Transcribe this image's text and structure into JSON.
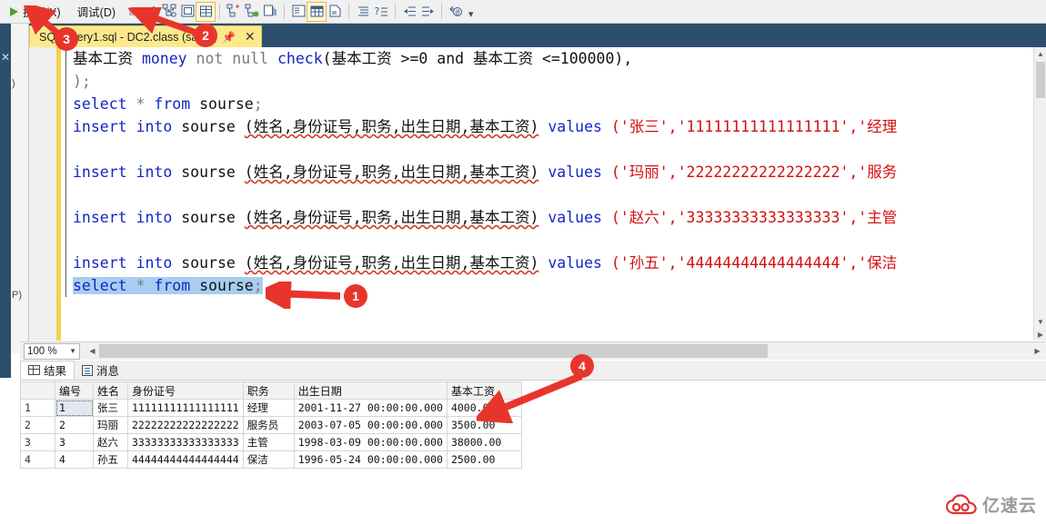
{
  "toolbar": {
    "run_label": "执行(X)",
    "debug_label": "调试(D)",
    "icons": [
      {
        "name": "run-icon"
      },
      {
        "name": "stop-icon"
      },
      {
        "name": "parse-check-icon"
      },
      {
        "name": "display-estimated-execution-plan-icon"
      },
      {
        "name": "query-options-icon"
      },
      {
        "name": "include-actual-execution-plan-icon"
      },
      {
        "name": "include-client-statistics-icon"
      },
      {
        "name": "include-live-query-statistics-icon"
      },
      {
        "name": "specify-values-for-template-parameters-icon"
      },
      {
        "name": "results-to-text-icon"
      },
      {
        "name": "results-to-grid-icon"
      },
      {
        "name": "results-to-file-icon"
      },
      {
        "name": "comment-out-icon"
      },
      {
        "name": "uncomment-icon"
      },
      {
        "name": "decrease-indent-icon"
      },
      {
        "name": "increase-indent-icon"
      },
      {
        "name": "connection-icon"
      },
      {
        "name": "toolbar-overflow-icon"
      }
    ]
  },
  "tab": {
    "title": "SQLQuery1.sql - DC2.class (sa (5",
    "pin_icon": "pin-icon",
    "close_icon": "close-icon"
  },
  "editor": {
    "lines": [
      {
        "id": "l1",
        "text": "基本工资 money not null check(基本工资 >=0 and 基本工资 <=100000),"
      },
      {
        "id": "l2",
        "text": ");"
      },
      {
        "id": "l3",
        "text": "select * from sourse;"
      },
      {
        "id": "l4",
        "text": "insert into sourse (姓名,身份证号,职务,出生日期,基本工资) values ('张三','11111111111111111','经理"
      },
      {
        "id": "l5",
        "text": ""
      },
      {
        "id": "l6",
        "text": "insert into sourse (姓名,身份证号,职务,出生日期,基本工资) values ('玛丽','22222222222222222','服务"
      },
      {
        "id": "l7",
        "text": ""
      },
      {
        "id": "l8",
        "text": "insert into sourse (姓名,身份证号,职务,出生日期,基本工资) values ('赵六','33333333333333333','主管"
      },
      {
        "id": "l9",
        "text": ""
      },
      {
        "id": "l10",
        "text": "insert into sourse (姓名,身份证号,职务,出生日期,基本工资) values ('孙五','44444444444444444','保洁"
      },
      {
        "id": "l11",
        "text": "select * from sourse;"
      }
    ],
    "tokens": {
      "kw_money": "money",
      "kw_not": "not",
      "kw_null": "null",
      "kw_check": "check",
      "kw_select": "select",
      "kw_from": "from",
      "kw_insert": "insert",
      "kw_into": "into",
      "kw_values": "values",
      "col_salary": "基本工资",
      "col_name": "姓名",
      "col_idcard": "身份证号",
      "col_title": "职务",
      "col_birth": "出生日期",
      "tbl_sourse": "sourse",
      "star": "*",
      "semi": ";",
      "close_paren": ");",
      "check_cond": "(基本工资 >=0 and 基本工资 <=100000),",
      "cols_paren": "(姓名,身份证号,职务,出生日期,基本工资)",
      "v1": "('张三','11111111111111111','经理",
      "v2": "('玛丽','22222222222222222','服务",
      "v3": "('赵六','33333333333333333','主管",
      "v4": "('孙五','44444444444444444','保洁"
    }
  },
  "zoom": {
    "value": "100 %",
    "caret_icon": "chevron-down-icon"
  },
  "results_tabs": [
    {
      "label": "结果",
      "icon": "grid-icon",
      "active": true
    },
    {
      "label": "消息",
      "icon": "messages-icon",
      "active": false
    }
  ],
  "results_grid": {
    "columns": [
      "",
      "编号",
      "姓名",
      "身份证号",
      "职务",
      "出生日期",
      "基本工资"
    ],
    "rows": [
      {
        "n": "1",
        "cells": [
          "1",
          "张三",
          "11111111111111111",
          "经理",
          "2001-11-27 00:00:00.000",
          "4000.00"
        ]
      },
      {
        "n": "2",
        "cells": [
          "2",
          "玛丽",
          "22222222222222222",
          "服务员",
          "2003-07-05 00:00:00.000",
          "3500.00"
        ]
      },
      {
        "n": "3",
        "cells": [
          "3",
          "赵六",
          "33333333333333333",
          "主管",
          "1998-03-09 00:00:00.000",
          "38000.00"
        ]
      },
      {
        "n": "4",
        "cells": [
          "4",
          "孙五",
          "44444444444444444",
          "保洁",
          "1996-05-24 00:00:00.000",
          "2500.00"
        ]
      }
    ]
  },
  "left_panel": {
    "fragment_top": ")",
    "fragment_bottom": "P)"
  },
  "annotations": [
    {
      "id": "a1",
      "label": "1"
    },
    {
      "id": "a2",
      "label": "2"
    },
    {
      "id": "a3",
      "label": "3"
    },
    {
      "id": "a4",
      "label": "4"
    }
  ],
  "watermark": {
    "text": "亿速云",
    "logo_icon": "cloud-logo-icon"
  },
  "colors": {
    "accent_blue": "#2d4f6e",
    "tab_yellow": "#fde98c",
    "annotation_red": "#e8352b",
    "keyword_blue": "#1226c4",
    "string_red": "#d40f0f",
    "selection_blue": "#a8cdf0",
    "change_bar_yellow": "#f2d34b"
  }
}
